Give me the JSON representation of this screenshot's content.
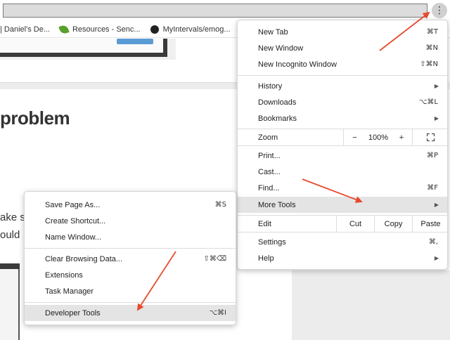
{
  "bookmarks": {
    "items": [
      {
        "label": "| Daniel's De...",
        "icon": "bookmark-page-icon"
      },
      {
        "label": "Resources - Senc...",
        "icon": "leaf-icon"
      },
      {
        "label": "MyIntervals/emog...",
        "icon": "github-icon"
      }
    ]
  },
  "toolbar": {
    "menu_glyph": "⋮"
  },
  "page": {
    "heading": "problem",
    "fragment1": "ake s",
    "fragment2": "ould"
  },
  "chrome_menu": {
    "new_tab": {
      "label": "New Tab",
      "shortcut": "⌘T"
    },
    "new_window": {
      "label": "New Window",
      "shortcut": "⌘N"
    },
    "new_incognito": {
      "label": "New Incognito Window",
      "shortcut": "⇧⌘N"
    },
    "history": {
      "label": "History",
      "arrow": "▶"
    },
    "downloads": {
      "label": "Downloads",
      "shortcut": "⌥⌘L"
    },
    "bookmarks": {
      "label": "Bookmarks",
      "arrow": "▶"
    },
    "zoom": {
      "label": "Zoom",
      "minus": "−",
      "value": "100%",
      "plus": "+"
    },
    "print": {
      "label": "Print...",
      "shortcut": "⌘P"
    },
    "cast": {
      "label": "Cast..."
    },
    "find": {
      "label": "Find...",
      "shortcut": "⌘F"
    },
    "more_tools": {
      "label": "More Tools",
      "arrow": "▶"
    },
    "edit": {
      "label": "Edit",
      "cut": "Cut",
      "copy": "Copy",
      "paste": "Paste"
    },
    "settings": {
      "label": "Settings",
      "shortcut": "⌘,"
    },
    "help": {
      "label": "Help",
      "arrow": "▶"
    }
  },
  "more_tools_menu": {
    "save_page": {
      "label": "Save Page As...",
      "shortcut": "⌘S"
    },
    "create_shortcut": {
      "label": "Create Shortcut..."
    },
    "name_window": {
      "label": "Name Window..."
    },
    "clear_data": {
      "label": "Clear Browsing Data...",
      "shortcut": "⇧⌘⌫"
    },
    "extensions": {
      "label": "Extensions"
    },
    "task_manager": {
      "label": "Task Manager"
    },
    "dev_tools": {
      "label": "Developer Tools",
      "shortcut": "⌥⌘I"
    }
  },
  "colors": {
    "annotation_arrow": "#e8492f",
    "highlight": "#e4e4e4"
  }
}
